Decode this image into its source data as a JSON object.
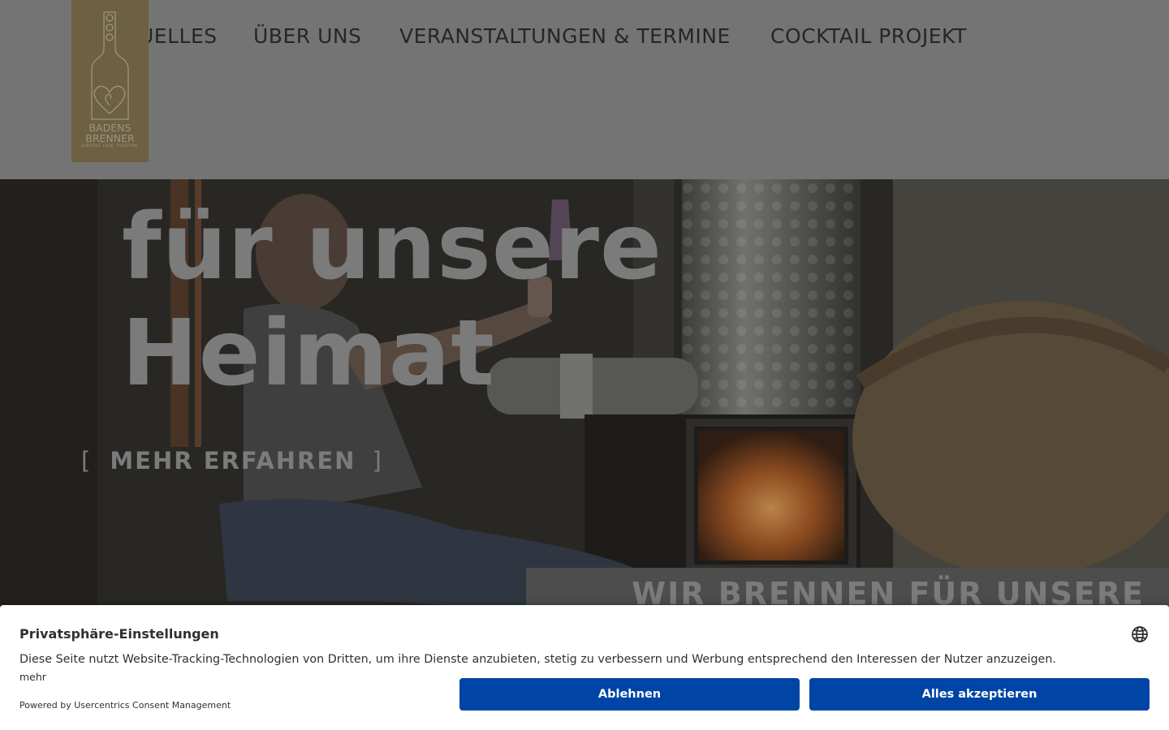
{
  "header": {
    "logo": {
      "line1": "BADENS",
      "line2": "BRENNER",
      "tagline": "SORGFALT. LIEBE. TRADITION."
    },
    "nav": [
      {
        "label": "AKTUELLES",
        "visible_label": "UELLES"
      },
      {
        "label": "ÜBER UNS"
      },
      {
        "label": "VERANSTALTUNGEN & TERMINE"
      },
      {
        "label": "COCKTAIL PROJEKT"
      }
    ]
  },
  "hero": {
    "top_partial": "WIR BRENNEN",
    "line1": "für unsere",
    "line2": "Heimat",
    "cta_open": "[",
    "cta_label": "MEHR ERFAHREN",
    "cta_close": "]",
    "tagline": "WIR BRENNEN FÜR UNSERE"
  },
  "consent": {
    "title": "Privatsphäre-Einstellungen",
    "description": "Diese Seite nutzt Website-Tracking-Technologien von Dritten, um ihre Dienste anzubieten, stetig zu verbessern und Werbung entsprechend den Interessen der Nutzer anzuzeigen.",
    "more_link": "mehr",
    "powered_by": "Powered by Usercentrics Consent Management",
    "deny_label": "Ablehnen",
    "accept_label": "Alles akzeptieren",
    "language_icon": "globe-icon"
  },
  "colors": {
    "header_bg": "#747474",
    "logo_bg": "#6d6043",
    "logo_fg": "#9b957f",
    "hero_text": "#7b7b7b",
    "button_bg": "#0045a5",
    "button_text": "#ffffff"
  }
}
